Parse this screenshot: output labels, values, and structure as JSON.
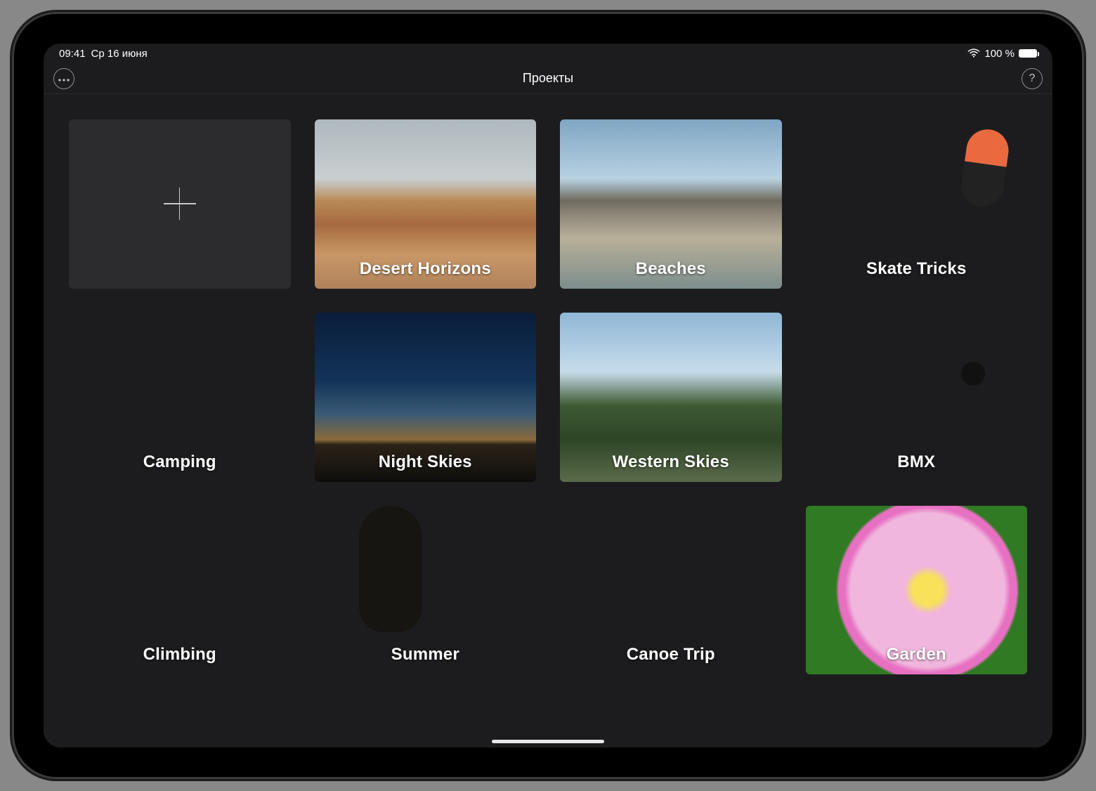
{
  "status": {
    "time": "09:41",
    "date": "Ср 16 июня",
    "battery_text": "100 %"
  },
  "toolbar": {
    "title": "Проекты"
  },
  "projects": [
    {
      "title": "Desert Horizons",
      "thumb_class": "t-desert"
    },
    {
      "title": "Beaches",
      "thumb_class": "t-beaches"
    },
    {
      "title": "Skate Tricks",
      "thumb_class": "t-skate"
    },
    {
      "title": "Camping",
      "thumb_class": "t-camping"
    },
    {
      "title": "Night Skies",
      "thumb_class": "t-night"
    },
    {
      "title": "Western Skies",
      "thumb_class": "t-western"
    },
    {
      "title": "BMX",
      "thumb_class": "t-bmx"
    },
    {
      "title": "Climbing",
      "thumb_class": "t-climbing"
    },
    {
      "title": "Summer",
      "thumb_class": "t-summer"
    },
    {
      "title": "Canoe Trip",
      "thumb_class": "t-canoe"
    },
    {
      "title": "Garden",
      "thumb_class": "t-garden"
    }
  ]
}
